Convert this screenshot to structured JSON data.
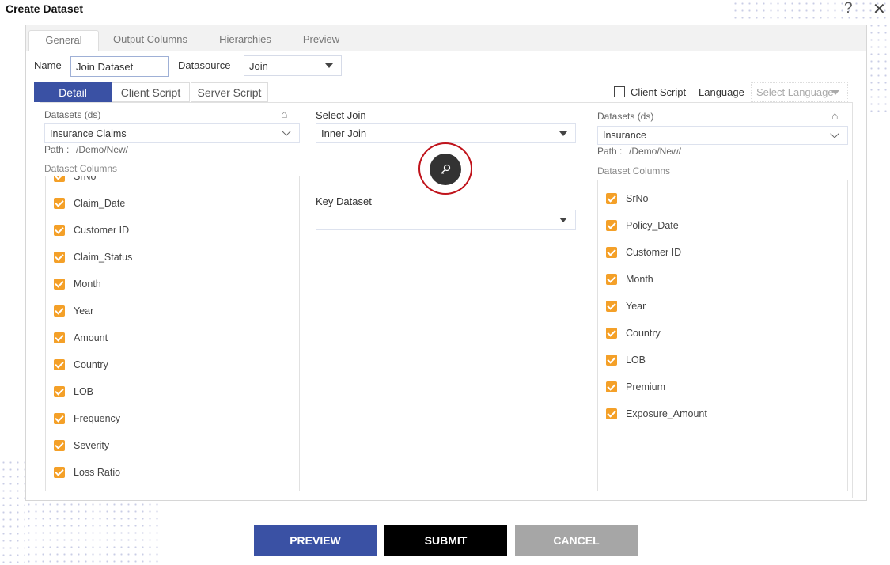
{
  "dialog": {
    "title": "Create Dataset",
    "help_icon": "question-icon",
    "close_icon": "close-icon"
  },
  "tabs": [
    {
      "label": "General",
      "active": true
    },
    {
      "label": "Output Columns"
    },
    {
      "label": "Hierarchies"
    },
    {
      "label": "Preview"
    }
  ],
  "general": {
    "name_label": "Name",
    "name_value": "Join Dataset",
    "datasource_label": "Datasource",
    "datasource_value": "Join"
  },
  "subtabs": [
    {
      "label": "Detail",
      "active": true
    },
    {
      "label": "Client Script"
    },
    {
      "label": "Server Script"
    }
  ],
  "client_script": {
    "label": "Client Script",
    "checked": false
  },
  "language": {
    "label": "Language",
    "placeholder": "Select Language"
  },
  "left": {
    "datasets_label": "Datasets (ds)",
    "dataset_value": "Insurance Claims",
    "path_label": "Path :",
    "path_value": "/Demo/New/",
    "columns_label": "Dataset Columns",
    "columns": [
      "SrNo",
      "Claim_Date",
      "Customer ID",
      "Claim_Status",
      "Month",
      "Year",
      "Amount",
      "Country",
      "LOB",
      "Frequency",
      "Severity",
      "Loss Ratio"
    ]
  },
  "middle": {
    "select_join_label": "Select Join",
    "select_join_value": "Inner Join",
    "key_button_icon": "key-icon",
    "key_dataset_label": "Key Dataset",
    "key_dataset_value": ""
  },
  "right": {
    "datasets_label": "Datasets (ds)",
    "dataset_value": "Insurance",
    "path_label": "Path :",
    "path_value": "/Demo/New/",
    "columns_label": "Dataset Columns",
    "columns": [
      "SrNo",
      "Policy_Date",
      "Customer ID",
      "Month",
      "Year",
      "Country",
      "LOB",
      "Premium",
      "Exposure_Amount"
    ]
  },
  "footer": {
    "preview": "PREVIEW",
    "submit": "SUBMIT",
    "cancel": "CANCEL"
  },
  "colors": {
    "primary": "#3a51a4",
    "checkbox": "#f4a028",
    "highlight_ring": "#c0141c",
    "submit": "#000000",
    "cancel": "#a6a6a6"
  }
}
